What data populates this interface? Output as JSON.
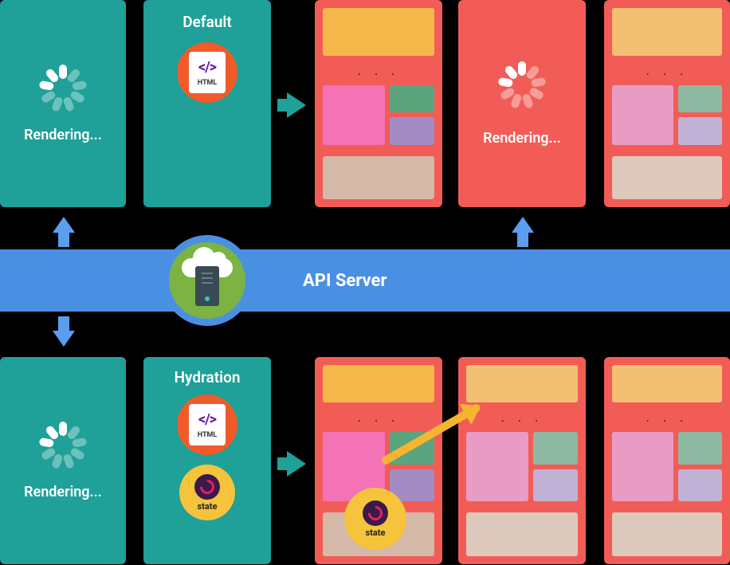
{
  "topRow": {
    "renderCard1": {
      "label": "Rendering..."
    },
    "defaultCard": {
      "title": "Default",
      "htmlBadge": {
        "code": "</>",
        "label": "HTML"
      }
    },
    "spinnerCard": {
      "label": "Rendering..."
    },
    "dots": ". . ."
  },
  "apiBar": {
    "label": "API Server"
  },
  "bottomRow": {
    "renderCard2": {
      "label": "Rendering..."
    },
    "hydrationCard": {
      "title": "Hydration",
      "htmlBadge": {
        "code": "</>",
        "label": "HTML"
      },
      "stateBadge": {
        "label": "state"
      }
    },
    "floatingState": {
      "label": "state"
    },
    "dots": ". . ."
  }
}
